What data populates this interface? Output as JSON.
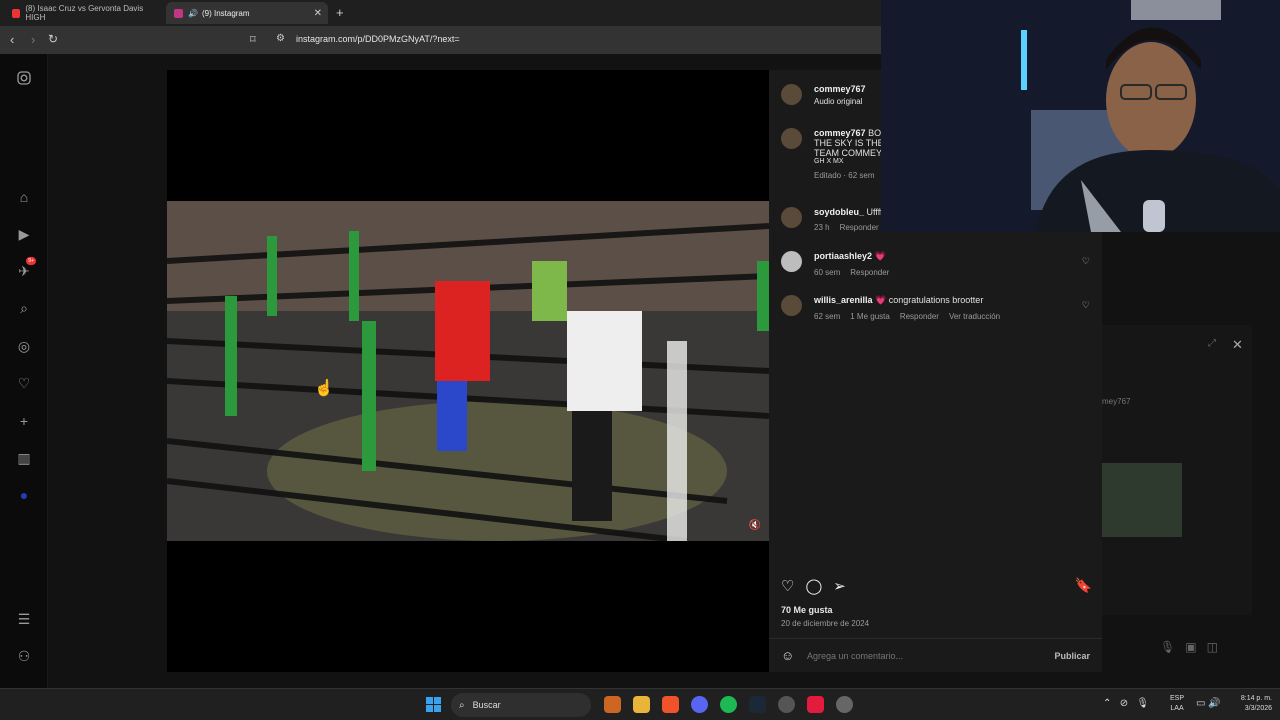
{
  "tabs": [
    {
      "label": "(8) Isaac Cruz vs Gervonta Davis HIGH",
      "color": "#e33"
    },
    {
      "label": "(9) Instagram",
      "color": "#c13584"
    }
  ],
  "address": {
    "url": "instagram.com/p/DD0PMzGNyAT/?next="
  },
  "sidebar": {
    "icons": [
      "instagram-logo-icon",
      "home-icon",
      "reels-icon",
      "send-icon",
      "search-icon",
      "explore-icon",
      "heart-icon",
      "plus-icon",
      "insights-icon",
      "avatar-icon",
      "menu-icon",
      "threads-icon"
    ],
    "notif_badge": "9+"
  },
  "post": {
    "author": "commey767",
    "author_sub": "Audio original",
    "caption_user": "commey767",
    "caption_lines": [
      "BO",
      "THE SKY IS THE L",
      "TEAM COMMEY",
      "GH X MX"
    ],
    "caption_meta": "Editado · 62 sem",
    "comments": [
      {
        "user": "soydobleu_",
        "text": "Uffff",
        "time": "23 h",
        "reply": "Responder",
        "likes": "",
        "translate": ""
      },
      {
        "user": "portiaashley2",
        "text": "💗",
        "time": "60 sem",
        "reply": "Responder",
        "likes": "",
        "translate": ""
      },
      {
        "user": "willis_arenilla",
        "text": "💗 congratulations brootter",
        "time": "62 sem",
        "reply": "Responder",
        "likes": "1 Me gusta",
        "translate": "Ver traducción"
      }
    ],
    "likes": "70 Me gusta",
    "date": "20 de diciembre de 2024",
    "comment_placeholder": "Agrega un comentario...",
    "publish": "Publicar"
  },
  "bgchat": {
    "user": "mey767"
  },
  "taskbar": {
    "search": "Buscar",
    "lang_top": "ESP",
    "lang_bottom": "LAA",
    "time": "8:14 p. m.",
    "date": "3/3/2026"
  }
}
